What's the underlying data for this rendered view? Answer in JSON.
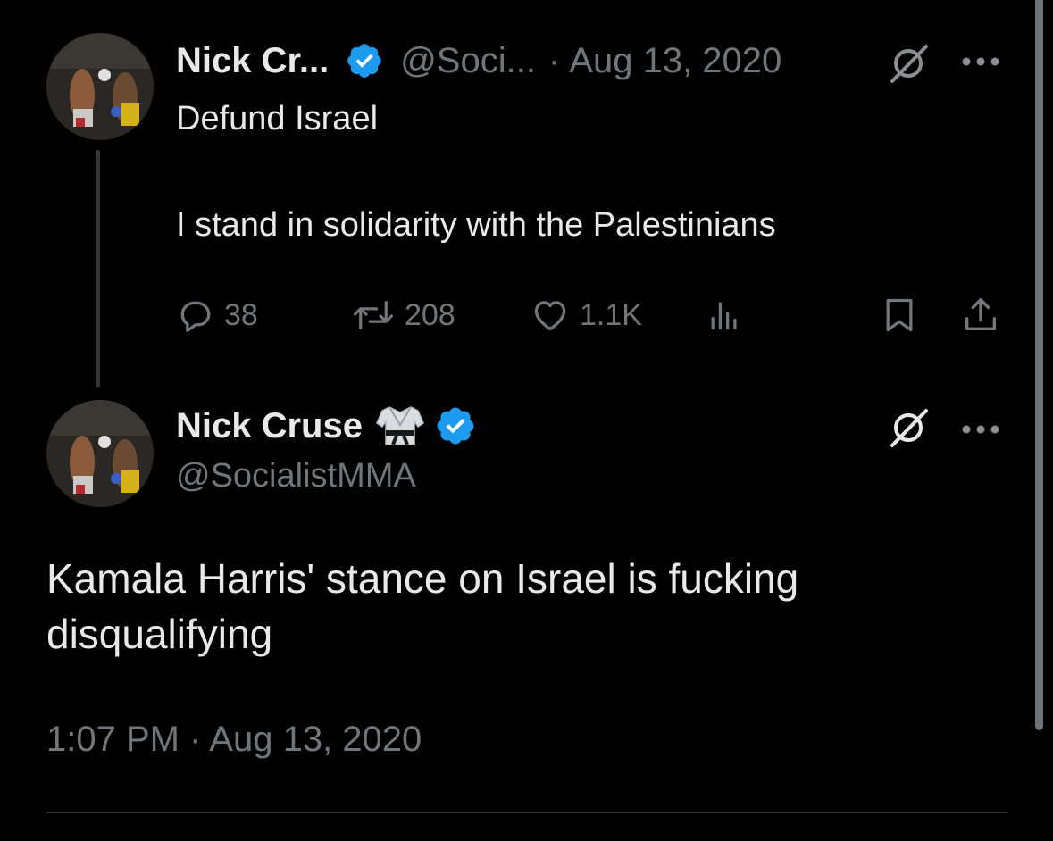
{
  "colors": {
    "background": "#000000",
    "text": "#e7e9ea",
    "muted": "#71767b",
    "verified": "#1d9bf0"
  },
  "reply_tweet": {
    "display_name": "Nick Cr...",
    "handle": "@Soci...",
    "separator": "·",
    "date": "Aug 13, 2020",
    "text_line1": "Defund Israel",
    "text_line2": "I stand in solidarity with the Palestinians",
    "icons": [
      "verified-badge-icon",
      "grok-icon",
      "more-icon"
    ],
    "stats": {
      "replies": "38",
      "reposts": "208",
      "likes": "1.1K"
    },
    "action_icons": [
      "reply-icon",
      "repost-icon",
      "like-icon",
      "views-icon",
      "bookmark-icon",
      "share-icon"
    ]
  },
  "main_tweet": {
    "display_name": "Nick Cruse",
    "handle": "@SocialistMMA",
    "text": "Kamala Harris' stance on Israel is fucking disqualifying",
    "timestamp": "1:07 PM · Aug 13, 2020",
    "icons": [
      "gi-emoji-icon",
      "verified-badge-icon",
      "grok-icon",
      "more-icon"
    ]
  }
}
